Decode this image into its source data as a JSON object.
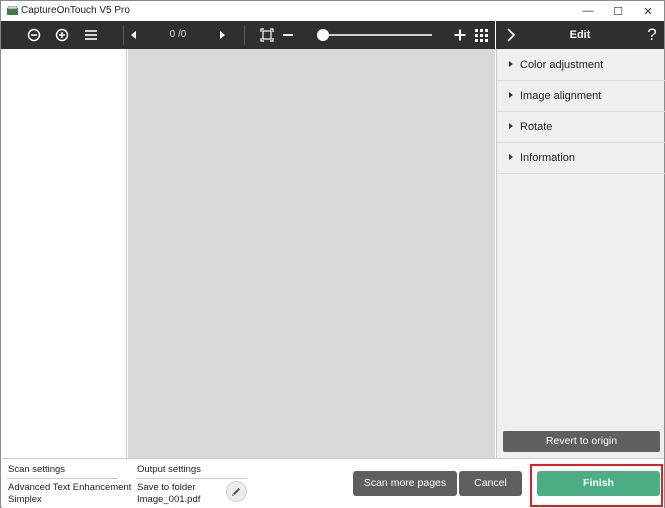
{
  "window": {
    "title": "CaptureOnTouch V5 Pro",
    "controls": {
      "minimize": "—",
      "maximize": "☐",
      "close": "✕"
    }
  },
  "toolbar": {
    "page_count": "0 /0",
    "zoom_level": 0.0
  },
  "edit_panel": {
    "title": "Edit",
    "help": "?",
    "sections": [
      {
        "label": "Color adjustment"
      },
      {
        "label": "Image alignment"
      },
      {
        "label": "Rotate"
      },
      {
        "label": "Information"
      }
    ],
    "revert_label": "Revert to origin"
  },
  "bottom": {
    "scan_settings": {
      "heading": "Scan settings",
      "line1": "Advanced Text Enhancement",
      "line2": "Simplex"
    },
    "output_settings": {
      "heading": "Output settings",
      "line1": "Save to folder",
      "line2": "Image_001.pdf"
    },
    "scan_more_label": "Scan more pages",
    "cancel_label": "Cancel",
    "finish_label": "Finish"
  },
  "colors": {
    "toolbar_bg": "#2f2f2f",
    "preview_bg": "#d9d9d9",
    "finish_bg": "#4caf83",
    "highlight_border": "#e02020"
  }
}
